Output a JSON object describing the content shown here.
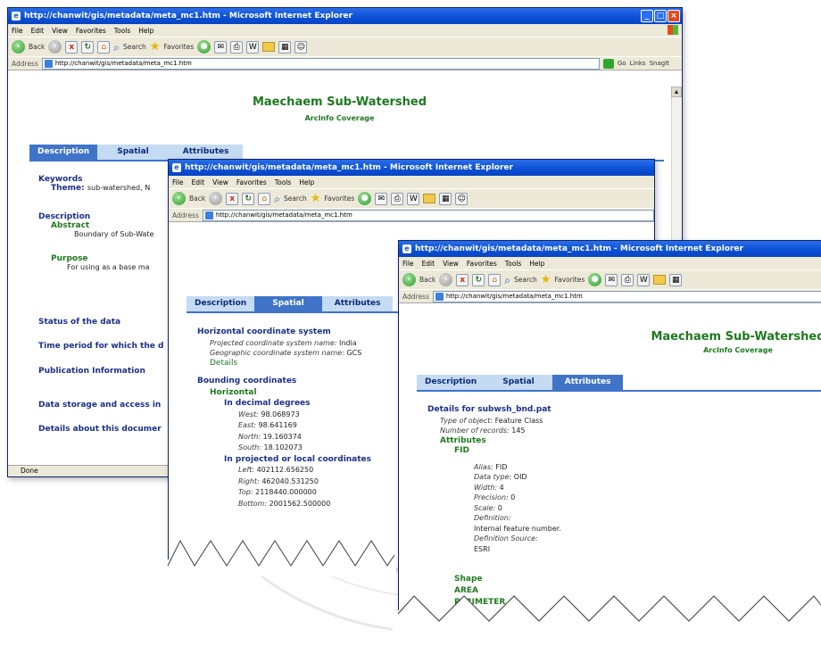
{
  "windows": [
    {
      "title": "http://chanwit/gis/metadata/meta_mc1.htm - Microsoft Internet Explorer",
      "menu": [
        "File",
        "Edit",
        "View",
        "Favorites",
        "Tools",
        "Help"
      ],
      "toolbar": {
        "back": "Back",
        "search": "Search",
        "favorites": "Favorites"
      },
      "address": {
        "label": "Address",
        "url": "http://chanwit/gis/metadata/meta_mc1.htm",
        "go": "Go",
        "links": "Links",
        "snagit": "SnagIt"
      },
      "status": "Done",
      "page": {
        "title": "Maechaem Sub-Watershed",
        "subtitle": "ArcInfo Coverage",
        "tabs": [
          "Description",
          "Spatial",
          "Attributes"
        ],
        "keywords": {
          "heading": "Keywords",
          "theme_label": "Theme:",
          "theme_value": "sub-watershed, N"
        },
        "description": {
          "heading": "Description",
          "abstract_label": "Abstract",
          "abstract_value": "Boundary of Sub-Wate",
          "purpose_label": "Purpose",
          "purpose_value": "For using as a base ma"
        },
        "links": [
          "Status of the data",
          "Time period for which the d",
          "Publication Information",
          "Data storage and access in",
          "Details about this documer"
        ]
      }
    },
    {
      "title": "http://chanwit/gis/metadata/meta_mc1.htm - Microsoft Internet Explorer",
      "menu": [
        "File",
        "Edit",
        "View",
        "Favorites",
        "Tools",
        "Help"
      ],
      "toolbar": {
        "back": "Back",
        "search": "Search",
        "favorites": "Favorites"
      },
      "address": {
        "label": "Address",
        "url": "http://chanwit/gis/metadata/meta_mc1.htm"
      },
      "page": {
        "tabs": [
          "Description",
          "Spatial",
          "Attributes"
        ],
        "hcs": {
          "heading": "Horizontal coordinate system",
          "proj_label": "Projected coordinate system name:",
          "proj_value": "India",
          "geo_label": "Geographic coordinate system name:",
          "geo_value": "GCS",
          "details": "Details"
        },
        "bounding": {
          "heading": "Bounding coordinates",
          "horizontal": "Horizontal",
          "decimal_heading": "In decimal degrees",
          "west_label": "West:",
          "west": "98.068973",
          "east_label": "East:",
          "east": "98.641169",
          "north_label": "North:",
          "north": "19.160374",
          "south_label": "South:",
          "south": "18.102073",
          "proj_heading": "In projected or local coordinates",
          "left_label": "Left:",
          "left": "402112.656250",
          "right_label": "Right:",
          "right": "462040.531250",
          "top_label": "Top:",
          "top": "2118440.000000",
          "bottom_label": "Bottom:",
          "bottom": "2001562.500000"
        }
      }
    },
    {
      "title": "http://chanwit/gis/metadata/meta_mc1.htm - Microsoft Internet Explorer",
      "menu": [
        "File",
        "Edit",
        "View",
        "Favorites",
        "Tools",
        "Help"
      ],
      "toolbar": {
        "back": "Back",
        "search": "Search",
        "favorites": "Favorites"
      },
      "address": {
        "label": "Address",
        "url": "http://chanwit/gis/metadata/meta_mc1.htm"
      },
      "page": {
        "title": "Maechaem Sub-Watershed",
        "subtitle": "ArcInfo Coverage",
        "tabs": [
          "Description",
          "Spatial",
          "Attributes"
        ],
        "details_heading": "Details for subwsh_bnd.pat",
        "type_label": "Type of object:",
        "type_value": "Feature Class",
        "records_label": "Number of records:",
        "records_value": "145",
        "attributes_heading": "Attributes",
        "fid": {
          "name": "FID",
          "alias_label": "Alias:",
          "alias_value": "FID",
          "dtype_label": "Data type:",
          "dtype_value": "OID",
          "width_label": "Width:",
          "width_value": "4",
          "precision_label": "Precision:",
          "precision_value": "0",
          "scale_label": "Scale:",
          "scale_value": "0",
          "definition_label": "Definition:",
          "definition_value": "Internal feature number.",
          "source_label": "Definition Source:",
          "source_value": "ESRI"
        },
        "more_fields": [
          "Shape",
          "AREA",
          "PERIMETER"
        ]
      }
    }
  ],
  "colors": {
    "title_green": "#1d7a1d",
    "nav_blue": "#1a2f8a",
    "tab_active": "#3f74c9",
    "tab_inactive": "#c4dbf3",
    "xp_title": "#0a4fd4"
  },
  "icons": [
    "ie-icon",
    "back-icon",
    "forward-icon",
    "stop-icon",
    "refresh-icon",
    "home-icon",
    "search-icon",
    "favorites-star-icon",
    "media-icon",
    "mail-icon",
    "print-icon",
    "edit-icon",
    "folder-icon",
    "windows-flag-icon"
  ]
}
